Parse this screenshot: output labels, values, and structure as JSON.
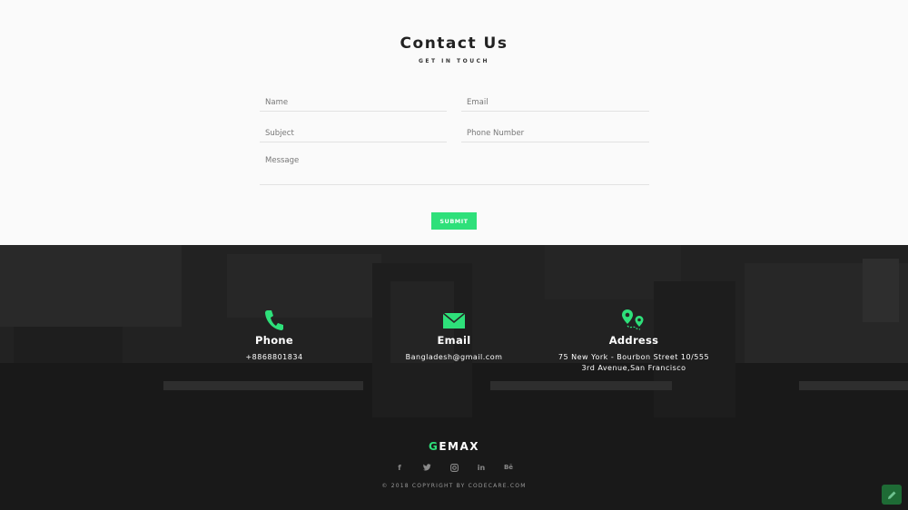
{
  "contact": {
    "title": "Contact Us",
    "subtitle": "GET IN TOUCH",
    "form": {
      "name_placeholder": "Name",
      "email_placeholder": "Email",
      "subject_placeholder": "Subject",
      "phone_placeholder": "Phone Number",
      "message_placeholder": "Message",
      "submit_label": "SUBMIT"
    }
  },
  "info": {
    "phone": {
      "icon": "phone-icon",
      "label": "Phone",
      "value": "+8868801834"
    },
    "email": {
      "icon": "envelope-icon",
      "label": "Email",
      "value": "Bangladesh@gmail.com"
    },
    "address": {
      "icon": "map-pin-icon",
      "label": "Address",
      "line1": "75 New York - Bourbon Street 10/555",
      "line2": "3rd Avenue,San Francisco"
    }
  },
  "footer": {
    "logo_accent": "G",
    "logo_rest": "EMAX",
    "socials": [
      {
        "icon": "facebook-icon",
        "glyph": "f"
      },
      {
        "icon": "twitter-icon",
        "glyph": "t"
      },
      {
        "icon": "instagram-icon",
        "glyph": "◙"
      },
      {
        "icon": "linkedin-icon",
        "glyph": "in"
      },
      {
        "icon": "behance-icon",
        "glyph": "Bē"
      }
    ],
    "copyright": "© 2018 COPYRIGHT BY CODECARE.COM"
  },
  "colors": {
    "accent": "#2ee07a",
    "dark_band": "#262626",
    "footer_bg": "#191919"
  }
}
